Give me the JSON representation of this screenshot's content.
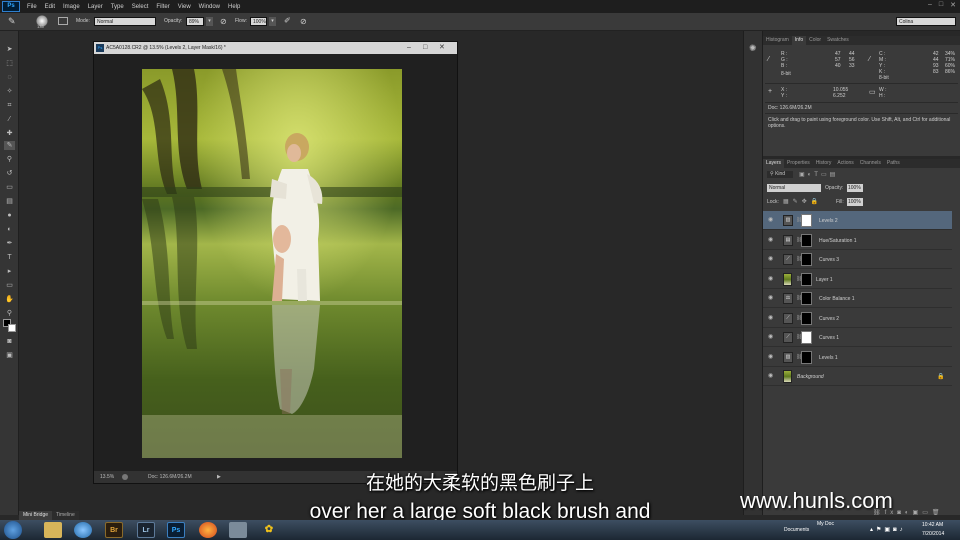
{
  "app": {
    "logo": "Ps"
  },
  "menu": [
    "File",
    "Edit",
    "Image",
    "Layer",
    "Type",
    "Select",
    "Filter",
    "View",
    "Window",
    "Help"
  ],
  "workspace": "Colina",
  "options": {
    "size": "135",
    "mode_label": "Mode:",
    "mode_value": "Normal",
    "opacity_label": "Opacity:",
    "opacity_value": "89%",
    "flow_label": "Flow:",
    "flow_value": "100%"
  },
  "document": {
    "title": "AC5A0128.CR2 @ 13.5% (Levels 2, Layer Mask/16) *",
    "zoom": "13.5%",
    "doc_size": "Doc: 126.6M/26.2M"
  },
  "info_panel": {
    "tabs": [
      "Histogram",
      "Info",
      "Color",
      "Swatches"
    ],
    "active_tab": "Info",
    "r": {
      "label": "R :",
      "v1": "47",
      "v2": "44"
    },
    "g": {
      "label": "G :",
      "v1": "57",
      "v2": "56"
    },
    "b": {
      "label": "B :",
      "v1": "40",
      "v2": "33"
    },
    "bit_left": "8-bit",
    "c": {
      "label": "C :",
      "v1": "42",
      "v2": "34%"
    },
    "m": {
      "label": "M :",
      "v1": "44",
      "v2": "71%"
    },
    "y": {
      "label": "Y :",
      "v1": "93",
      "v2": "60%"
    },
    "k": {
      "label": "K :",
      "v1": "83",
      "v2": "86%"
    },
    "bit_right": "8-bit",
    "x": {
      "label": "X :",
      "value": "10.055"
    },
    "yc": {
      "label": "Y :",
      "value": "6.252"
    },
    "w": {
      "label": "W :",
      "value": ""
    },
    "h": {
      "label": "H :",
      "value": ""
    },
    "doc": "Doc: 126.6M/26.2M",
    "hint": "Click and drag to paint using foreground color. Use Shift, Alt, and Ctrl for additional options."
  },
  "layers_panel": {
    "tabs": [
      "Layers",
      "Properties",
      "History",
      "Actions",
      "Channels",
      "Paths"
    ],
    "active_tab": "Layers",
    "kind": "Kind",
    "blend_mode": "Normal",
    "opacity_label": "Opacity:",
    "opacity": "100%",
    "lock_label": "Lock:",
    "fill_label": "Fill:",
    "fill": "100%",
    "layers": [
      {
        "name": "Levels 2",
        "type": "levels",
        "selected": true,
        "mask": "white"
      },
      {
        "name": "Hue/Saturation 1",
        "type": "huesat",
        "selected": false,
        "mask": "black"
      },
      {
        "name": "Curves 3",
        "type": "curves",
        "selected": false,
        "mask": "black"
      },
      {
        "name": "Layer 1",
        "type": "pixel",
        "selected": false,
        "mask": "black"
      },
      {
        "name": "Color Balance 1",
        "type": "colorbal",
        "selected": false,
        "mask": "black"
      },
      {
        "name": "Curves 2",
        "type": "curves",
        "selected": false,
        "mask": "black"
      },
      {
        "name": "Curves 1",
        "type": "curves",
        "selected": false,
        "mask": "white"
      },
      {
        "name": "Levels 1",
        "type": "levels",
        "selected": false,
        "mask": "black"
      },
      {
        "name": "Background",
        "type": "background",
        "selected": false,
        "mask": "none"
      }
    ]
  },
  "bottom_tabs": [
    "Mini Bridge",
    "Timeline"
  ],
  "subtitles": {
    "cn": "在她的大柔软的黑色刷子上",
    "en": "over her a large soft black brush and"
  },
  "watermark": "www.hunls.com",
  "taskbar": {
    "apps": [
      "Br",
      "Lr",
      "Ps"
    ],
    "tray_documents": "Documents",
    "tray_mydoc": "My Doc",
    "time": "10:42 AM",
    "date": "7/20/2014"
  }
}
